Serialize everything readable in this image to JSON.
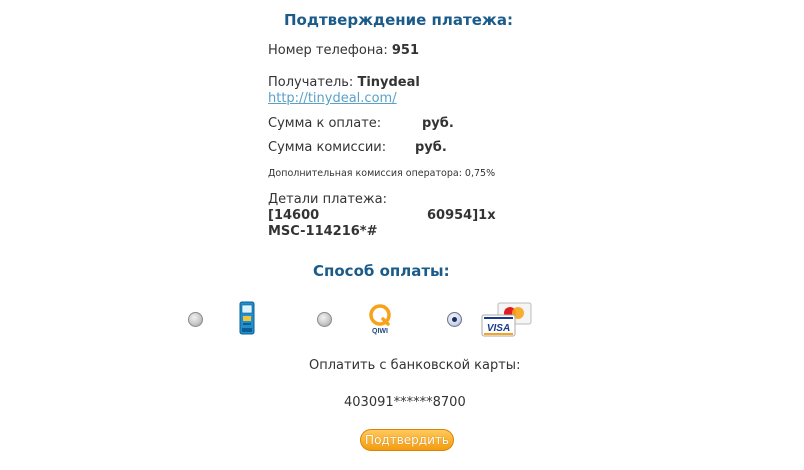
{
  "header": {
    "title": "Подтверждение платежа:"
  },
  "details": {
    "phone_label": "Номер телефона:",
    "phone_value": "951",
    "recipient_label": "Получатель:",
    "recipient_value": "Tinydeal",
    "recipient_url": "http://tinydeal.com/",
    "amount_label": "Сумма к оплате:",
    "amount_currency": "руб.",
    "fee_label": "Сумма комиссии:",
    "fee_currency": "руб.",
    "operator_fee_note": "Дополнительная комиссия оператора: 0,75%",
    "payment_details_label": "Детали платежа:",
    "payment_details_line1_a": "[14600",
    "payment_details_line1_b": "60954]1x",
    "payment_details_line2": "MSC-114216*#"
  },
  "payment_method": {
    "title": "Способ оплаты:",
    "options": [
      {
        "name": "terminal",
        "icon": "payment-terminal-icon",
        "selected": false
      },
      {
        "name": "qiwi",
        "icon": "qiwi-logo-icon",
        "label": "QIWI",
        "selected": false
      },
      {
        "name": "card",
        "icon": "visa-mastercard-icon",
        "label": "VISA",
        "selected": true
      }
    ]
  },
  "card": {
    "pay_label": "Оплатить с банковской карты:",
    "masked_number": "403091******8700"
  },
  "actions": {
    "confirm_label": "Подтвердить"
  },
  "colors": {
    "title": "#1a5b8a",
    "link": "#5aa1c8",
    "button": "#f39c0f"
  }
}
